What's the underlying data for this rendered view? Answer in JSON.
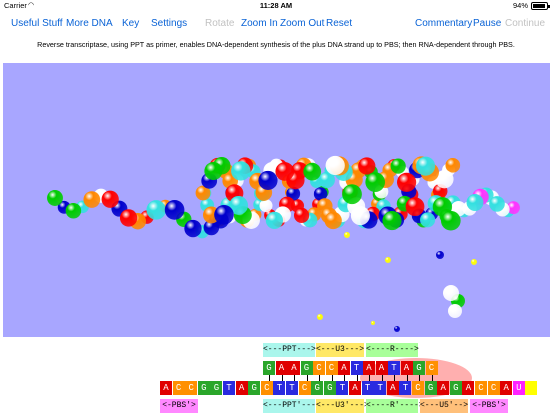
{
  "status_bar": {
    "carrier": "Carrier",
    "wifi_icon": "wifi-icon",
    "time": "11:28 AM",
    "battery_percent": "94%",
    "battery_level": 0.94
  },
  "toolbar": {
    "useful_stuff": "Useful Stuff",
    "more_dna": "More DNA",
    "key": "Key",
    "settings": "Settings",
    "rotate": "Rotate",
    "zoom_in": "Zoom In",
    "zoom_out": "Zoom Out",
    "reset": "Reset",
    "commentary": "Commentary",
    "pause": "Pause",
    "continue": "Continue"
  },
  "description": "Reverse transcriptase, using PPT as primer, enables DNA-dependent synthesis of the plus DNA strand up to PBS; then RNA-dependent through PBS.",
  "viewport": {
    "background": "#a8a6ff",
    "base_colors": [
      "#ff0000",
      "#0000cc",
      "#ff8800",
      "#00cc00",
      "#ffffff",
      "#33e0e0",
      "#ff33ff",
      "#ffff00"
    ]
  },
  "sequence": {
    "row1_labels": [
      "<---PPT--->",
      "<---U3--->",
      "<----R---->"
    ],
    "row2_bases": [
      "G",
      "A",
      "A",
      "G",
      "C",
      "C",
      "A",
      "T",
      "A",
      "A",
      "T",
      "A",
      "G",
      "C"
    ],
    "row3_bases": [
      "A",
      "C",
      "C",
      "G",
      "G",
      "T",
      "A",
      "G",
      "C",
      "T",
      "T",
      "C",
      "G",
      "G",
      "T",
      "A",
      "T",
      "T",
      "A",
      "T",
      "C",
      "G",
      "A",
      "G",
      "A",
      "C",
      "C",
      "A",
      "U",
      ""
    ],
    "row4_labels": [
      "<-PBS'>",
      "<---PPT'--->",
      "<---U3'--->",
      "<----R'---->",
      "<---U5'-->",
      "<-PBS'>"
    ]
  }
}
